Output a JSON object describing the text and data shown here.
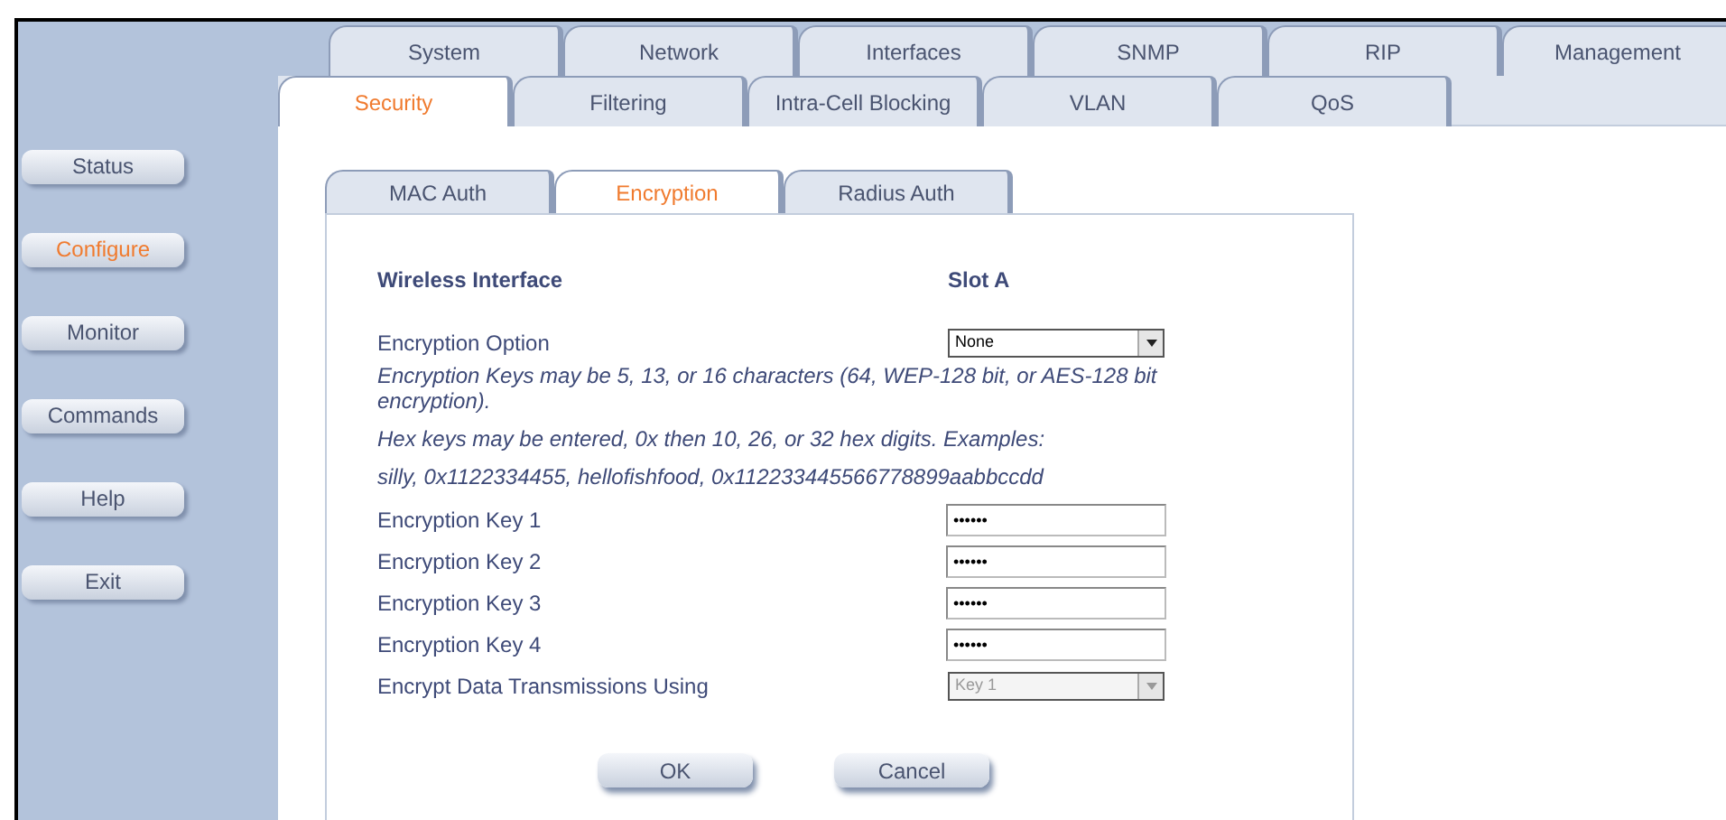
{
  "main_tabs": [
    {
      "label": "System",
      "selected": false
    },
    {
      "label": "Network",
      "selected": false
    },
    {
      "label": "Interfaces",
      "selected": false
    },
    {
      "label": "SNMP",
      "selected": false
    },
    {
      "label": "RIP",
      "selected": false
    },
    {
      "label": "Management",
      "selected": false
    }
  ],
  "sub_tabs": [
    {
      "label": "Security",
      "selected": true
    },
    {
      "label": "Filtering",
      "selected": false
    },
    {
      "label": "Intra-Cell Blocking",
      "selected": false
    },
    {
      "label": "VLAN",
      "selected": false
    },
    {
      "label": "QoS",
      "selected": false
    }
  ],
  "sidebar": {
    "items": [
      {
        "label": "Status",
        "selected": false
      },
      {
        "label": "Configure",
        "selected": true
      },
      {
        "label": "Monitor",
        "selected": false
      },
      {
        "label": "Commands",
        "selected": false
      },
      {
        "label": "Help",
        "selected": false
      },
      {
        "label": "Exit",
        "selected": false
      }
    ]
  },
  "section_tabs": [
    {
      "label": "MAC Auth",
      "selected": false
    },
    {
      "label": "Encryption",
      "selected": true
    },
    {
      "label": "Radius Auth",
      "selected": false
    }
  ],
  "form": {
    "header": {
      "label": "Wireless Interface",
      "value": "Slot A"
    },
    "encryption_option": {
      "label": "Encryption Option",
      "value": "None",
      "disabled": false
    },
    "notes": [
      "Encryption Keys may be 5, 13, or 16 characters (64, WEP-128 bit, or AES-128 bit encryption).",
      "Hex keys may be entered, 0x then 10, 26, or 32 hex digits. Examples:",
      "silly, 0x1122334455, hellofishfood, 0x112233445566778899aabbccdd"
    ],
    "keys": [
      {
        "label": "Encryption Key 1",
        "value": "••••••"
      },
      {
        "label": "Encryption Key 2",
        "value": "••••••"
      },
      {
        "label": "Encryption Key 3",
        "value": "••••••"
      },
      {
        "label": "Encryption Key 4",
        "value": "••••••"
      }
    ],
    "transmit_key": {
      "label": "Encrypt Data Transmissions Using",
      "value": "Key 1",
      "disabled": true
    }
  },
  "buttons": [
    "OK",
    "Cancel"
  ]
}
